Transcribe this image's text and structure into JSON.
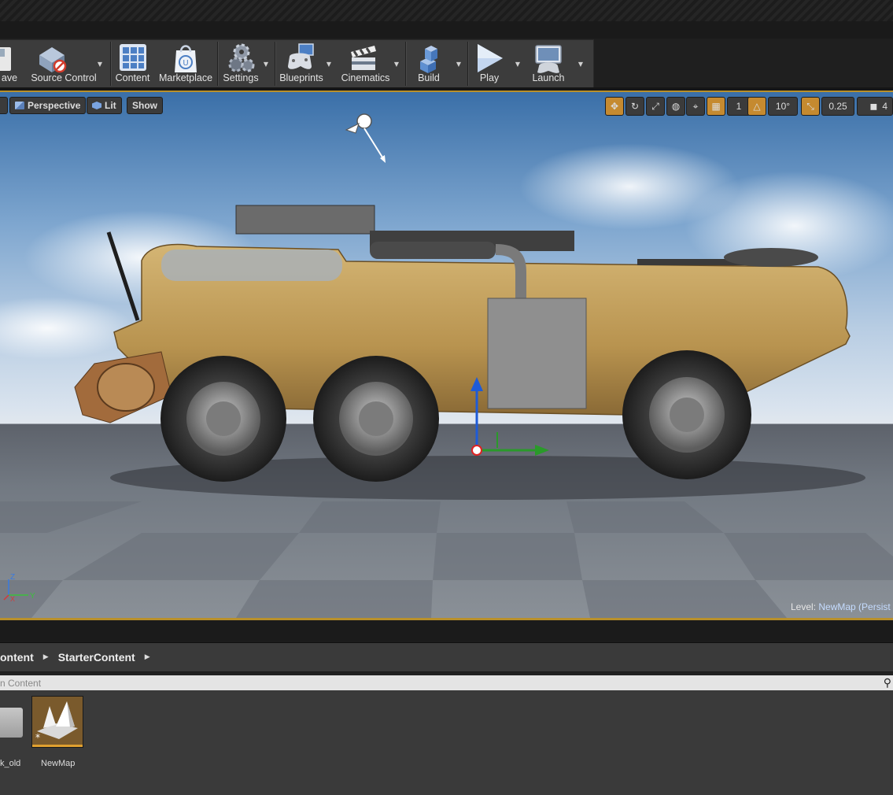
{
  "toolbar": {
    "items": [
      {
        "label": "ave",
        "icon": "save-icon"
      },
      {
        "label": "Source Control",
        "icon": "source-control-icon"
      },
      {
        "label": "Content",
        "icon": "content-icon"
      },
      {
        "label": "Marketplace",
        "icon": "marketplace-icon"
      },
      {
        "label": "Settings",
        "icon": "settings-icon"
      },
      {
        "label": "Blueprints",
        "icon": "blueprints-icon"
      },
      {
        "label": "Cinematics",
        "icon": "cinematics-icon"
      },
      {
        "label": "Build",
        "icon": "build-icon"
      },
      {
        "label": "Play",
        "icon": "play-icon"
      },
      {
        "label": "Launch",
        "icon": "launch-icon"
      }
    ]
  },
  "viewport": {
    "view_mode": "Perspective",
    "lighting": "Lit",
    "show": "Show",
    "grid_snap": "1",
    "rotation_snap": "10°",
    "scale_snap": "0.25",
    "camera_speed": "4",
    "level_label": "Level:",
    "level_value": "NewMap (Persist",
    "axis": {
      "z": "Z",
      "y": "Y",
      "x": "X"
    }
  },
  "breadcrumbs": [
    "ontent",
    "StarterContent"
  ],
  "search": {
    "placeholder": "n Content"
  },
  "assets": [
    {
      "label": "k_old",
      "icon": "folder-icon"
    },
    {
      "label": "NewMap",
      "icon": "map-icon"
    }
  ],
  "colors": {
    "accent": "#b8902a",
    "active_tool": "#c58a30",
    "level_name": "#c5dcff"
  }
}
